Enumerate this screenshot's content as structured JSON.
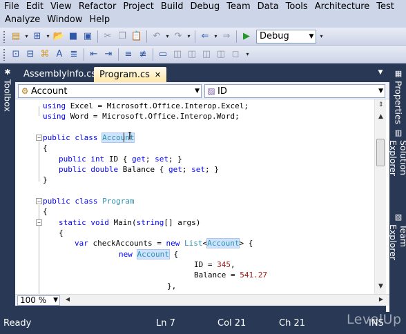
{
  "menu": {
    "row1": [
      "File",
      "Edit",
      "View",
      "Refactor",
      "Project",
      "Build",
      "Debug",
      "Team",
      "Data",
      "Tools",
      "Architecture",
      "Test"
    ],
    "row2": [
      "Analyze",
      "Window",
      "Help"
    ]
  },
  "toolbar": {
    "configuration": "Debug",
    "icons": [
      "new-project-icon",
      "add-item-icon",
      "open-file-icon",
      "save-icon",
      "save-all-icon",
      "cut-icon",
      "copy-icon",
      "paste-icon",
      "undo-icon",
      "redo-icon",
      "navigate-backward-icon",
      "start-debugging-icon"
    ]
  },
  "toolbar2": {
    "icons": [
      "symbol-icon",
      "quick-info-icon",
      "param-info-icon",
      "word-complete-icon",
      "show-parameters-icon",
      "outdent-icon",
      "indent-icon",
      "comment-icon",
      "uncomment-icon",
      "bookmark-icon",
      "prev-bookmark-icon",
      "next-bookmark-icon",
      "prev-bookmark-folder-icon",
      "next-bookmark-folder-icon",
      "clear-bookmarks-icon"
    ]
  },
  "side_panels": {
    "left": "Toolbox",
    "right": [
      "Properties",
      "Solution Explorer",
      "Team Explorer"
    ]
  },
  "tabs": {
    "inactive": "AssemblyInfo.cs",
    "active": "Program.cs"
  },
  "navigation": {
    "type_dropdown": "Account",
    "member_dropdown": "ID"
  },
  "code": {
    "l1_kw": "using",
    "l1_rest": " Excel = Microsoft.Office.Interop.Excel;",
    "l2_kw": "using",
    "l2_rest": " Word = Microsoft.Office.Interop.Word;",
    "l3_kw": "public class",
    "l3_name": "Account",
    "l4": "{",
    "l5_kw": "public int",
    "l5_mid": " ID { ",
    "l5_kw2": "get",
    "l5_s1": "; ",
    "l5_kw3": "set",
    "l5_s2": "; }",
    "l6_kw": "public double",
    "l6_mid": " Balance { ",
    "l6_kw2": "get",
    "l6_s1": "; ",
    "l6_kw3": "set",
    "l6_s2": "; }",
    "l7": "}",
    "l8_kw": "public class",
    "l8_name": "Program",
    "l9": "{",
    "l10_kw": "static void",
    "l10_mid": " Main(",
    "l10_kw2": "string",
    "l10_rest": "[] args)",
    "l11": "{",
    "l12_kw": "var",
    "l12_mid": " checkAccounts = ",
    "l12_kw2": "new",
    "l12_sp": " ",
    "l12_ty": "List",
    "l12_lt": "<",
    "l12_hl": "Account",
    "l12_rest": "> {",
    "l13_kw": "new",
    "l13_sp": " ",
    "l13_hl": "Account",
    "l13_rest": " {",
    "l14_a": "ID = ",
    "l14_num": "345",
    "l14_b": ",",
    "l15_a": "Balance = ",
    "l15_num": "541.27",
    "l16": "},"
  },
  "zoom": "100 %",
  "status": {
    "ready": "Ready",
    "line": "Ln 7",
    "col": "Col 21",
    "ch": "Ch 21",
    "ins": "INS"
  },
  "watermark": "LevelUp"
}
